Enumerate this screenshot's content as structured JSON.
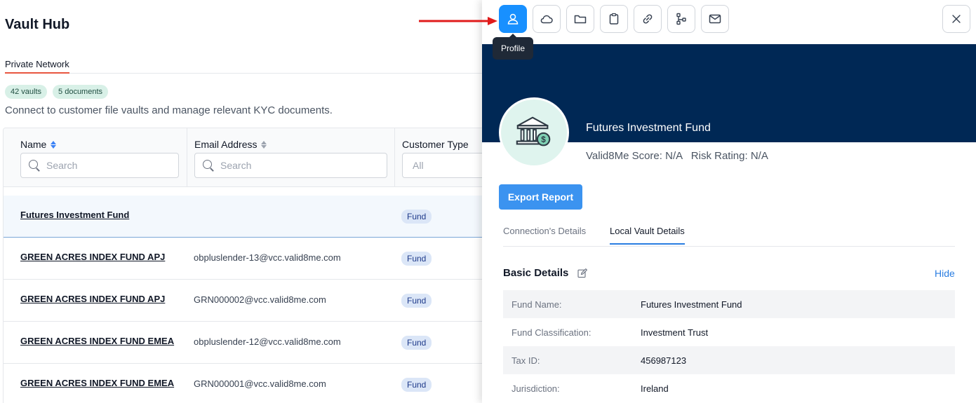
{
  "page": {
    "title": "Vault Hub",
    "tab_active": "Private Network",
    "badges": [
      "42 vaults",
      "5 documents"
    ],
    "subtitle": "Connect to customer file vaults and manage relevant KYC documents."
  },
  "table": {
    "columns": {
      "name": "Name",
      "email": "Email Address",
      "type": "Customer Type"
    },
    "filters": {
      "name_placeholder": "Search",
      "email_placeholder": "Search",
      "type_value": "All"
    },
    "rows": [
      {
        "name": "Futures Investment Fund",
        "email": "",
        "type": "Fund"
      },
      {
        "name": "GREEN ACRES INDEX FUND APJ",
        "email": "obpluslender-13@vcc.valid8me.com",
        "type": "Fund"
      },
      {
        "name": "GREEN ACRES INDEX FUND APJ",
        "email": "GRN000002@vcc.valid8me.com",
        "type": "Fund"
      },
      {
        "name": "GREEN ACRES INDEX FUND EMEA",
        "email": "obpluslender-12@vcc.valid8me.com",
        "type": "Fund"
      },
      {
        "name": "GREEN ACRES INDEX FUND EMEA",
        "email": "GRN000001@vcc.valid8me.com",
        "type": "Fund"
      }
    ]
  },
  "panel": {
    "tooltip": "Profile",
    "toolbar_icons": [
      "profile-icon",
      "cloud-icon",
      "folder-icon",
      "clipboard-icon",
      "link-icon",
      "hierarchy-icon",
      "mail-icon"
    ],
    "entity_name": "Futures Investment Fund",
    "score_text": "Valid8Me Score: N/A   Risk Rating: N/A",
    "export_label": "Export Report",
    "tabs": [
      "Connection's Details",
      "Local Vault Details"
    ],
    "section_title": "Basic Details",
    "hide_label": "Hide",
    "details": [
      {
        "label": "Fund Name:",
        "value": "Futures Investment Fund"
      },
      {
        "label": "Fund Classification:",
        "value": "Investment Trust"
      },
      {
        "label": "Tax ID:",
        "value": "456987123"
      },
      {
        "label": "Jurisdiction:",
        "value": "Ireland"
      }
    ]
  },
  "colors": {
    "accent": "#1890ff",
    "banner": "#002855",
    "export_button": "#3b93f0",
    "annotation_arrow": "#e01b1b"
  }
}
